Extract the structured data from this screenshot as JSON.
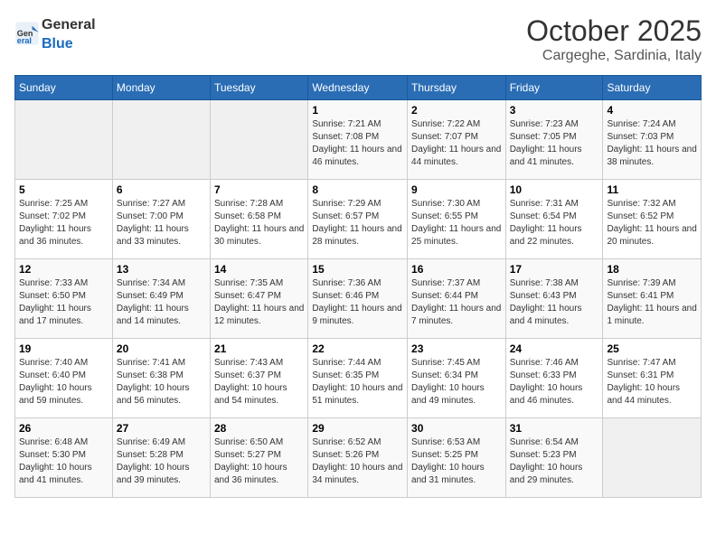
{
  "header": {
    "logo_general": "General",
    "logo_blue": "Blue",
    "month": "October 2025",
    "location": "Cargeghe, Sardinia, Italy"
  },
  "days_of_week": [
    "Sunday",
    "Monday",
    "Tuesday",
    "Wednesday",
    "Thursday",
    "Friday",
    "Saturday"
  ],
  "weeks": [
    [
      {
        "day": "",
        "info": ""
      },
      {
        "day": "",
        "info": ""
      },
      {
        "day": "",
        "info": ""
      },
      {
        "day": "1",
        "info": "Sunrise: 7:21 AM\nSunset: 7:08 PM\nDaylight: 11 hours and 46 minutes."
      },
      {
        "day": "2",
        "info": "Sunrise: 7:22 AM\nSunset: 7:07 PM\nDaylight: 11 hours and 44 minutes."
      },
      {
        "day": "3",
        "info": "Sunrise: 7:23 AM\nSunset: 7:05 PM\nDaylight: 11 hours and 41 minutes."
      },
      {
        "day": "4",
        "info": "Sunrise: 7:24 AM\nSunset: 7:03 PM\nDaylight: 11 hours and 38 minutes."
      }
    ],
    [
      {
        "day": "5",
        "info": "Sunrise: 7:25 AM\nSunset: 7:02 PM\nDaylight: 11 hours and 36 minutes."
      },
      {
        "day": "6",
        "info": "Sunrise: 7:27 AM\nSunset: 7:00 PM\nDaylight: 11 hours and 33 minutes."
      },
      {
        "day": "7",
        "info": "Sunrise: 7:28 AM\nSunset: 6:58 PM\nDaylight: 11 hours and 30 minutes."
      },
      {
        "day": "8",
        "info": "Sunrise: 7:29 AM\nSunset: 6:57 PM\nDaylight: 11 hours and 28 minutes."
      },
      {
        "day": "9",
        "info": "Sunrise: 7:30 AM\nSunset: 6:55 PM\nDaylight: 11 hours and 25 minutes."
      },
      {
        "day": "10",
        "info": "Sunrise: 7:31 AM\nSunset: 6:54 PM\nDaylight: 11 hours and 22 minutes."
      },
      {
        "day": "11",
        "info": "Sunrise: 7:32 AM\nSunset: 6:52 PM\nDaylight: 11 hours and 20 minutes."
      }
    ],
    [
      {
        "day": "12",
        "info": "Sunrise: 7:33 AM\nSunset: 6:50 PM\nDaylight: 11 hours and 17 minutes."
      },
      {
        "day": "13",
        "info": "Sunrise: 7:34 AM\nSunset: 6:49 PM\nDaylight: 11 hours and 14 minutes."
      },
      {
        "day": "14",
        "info": "Sunrise: 7:35 AM\nSunset: 6:47 PM\nDaylight: 11 hours and 12 minutes."
      },
      {
        "day": "15",
        "info": "Sunrise: 7:36 AM\nSunset: 6:46 PM\nDaylight: 11 hours and 9 minutes."
      },
      {
        "day": "16",
        "info": "Sunrise: 7:37 AM\nSunset: 6:44 PM\nDaylight: 11 hours and 7 minutes."
      },
      {
        "day": "17",
        "info": "Sunrise: 7:38 AM\nSunset: 6:43 PM\nDaylight: 11 hours and 4 minutes."
      },
      {
        "day": "18",
        "info": "Sunrise: 7:39 AM\nSunset: 6:41 PM\nDaylight: 11 hours and 1 minute."
      }
    ],
    [
      {
        "day": "19",
        "info": "Sunrise: 7:40 AM\nSunset: 6:40 PM\nDaylight: 10 hours and 59 minutes."
      },
      {
        "day": "20",
        "info": "Sunrise: 7:41 AM\nSunset: 6:38 PM\nDaylight: 10 hours and 56 minutes."
      },
      {
        "day": "21",
        "info": "Sunrise: 7:43 AM\nSunset: 6:37 PM\nDaylight: 10 hours and 54 minutes."
      },
      {
        "day": "22",
        "info": "Sunrise: 7:44 AM\nSunset: 6:35 PM\nDaylight: 10 hours and 51 minutes."
      },
      {
        "day": "23",
        "info": "Sunrise: 7:45 AM\nSunset: 6:34 PM\nDaylight: 10 hours and 49 minutes."
      },
      {
        "day": "24",
        "info": "Sunrise: 7:46 AM\nSunset: 6:33 PM\nDaylight: 10 hours and 46 minutes."
      },
      {
        "day": "25",
        "info": "Sunrise: 7:47 AM\nSunset: 6:31 PM\nDaylight: 10 hours and 44 minutes."
      }
    ],
    [
      {
        "day": "26",
        "info": "Sunrise: 6:48 AM\nSunset: 5:30 PM\nDaylight: 10 hours and 41 minutes."
      },
      {
        "day": "27",
        "info": "Sunrise: 6:49 AM\nSunset: 5:28 PM\nDaylight: 10 hours and 39 minutes."
      },
      {
        "day": "28",
        "info": "Sunrise: 6:50 AM\nSunset: 5:27 PM\nDaylight: 10 hours and 36 minutes."
      },
      {
        "day": "29",
        "info": "Sunrise: 6:52 AM\nSunset: 5:26 PM\nDaylight: 10 hours and 34 minutes."
      },
      {
        "day": "30",
        "info": "Sunrise: 6:53 AM\nSunset: 5:25 PM\nDaylight: 10 hours and 31 minutes."
      },
      {
        "day": "31",
        "info": "Sunrise: 6:54 AM\nSunset: 5:23 PM\nDaylight: 10 hours and 29 minutes."
      },
      {
        "day": "",
        "info": ""
      }
    ]
  ]
}
